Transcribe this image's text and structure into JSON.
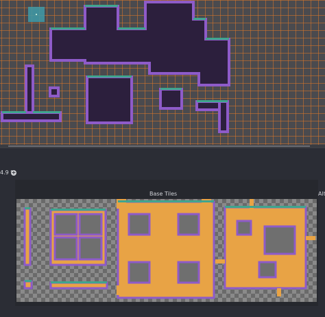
{
  "editor": {
    "zoom_label": "4.9 %",
    "zoom_button_icon": "plus-circle-icon"
  },
  "tileset": {
    "section_base_label": "Base Tiles",
    "section_alt_label": "Alt"
  },
  "colors": {
    "viewport_bg": "#4a4a4e",
    "grid_line": "#de7828",
    "tile_fill": "#2c1f3d",
    "tile_border": "#8e5bc9",
    "grass_top": "#3fa58e",
    "sheet_fill": "#e8a345",
    "cursor": "#3f9aa8",
    "panel_bg": "#2b2d35"
  }
}
